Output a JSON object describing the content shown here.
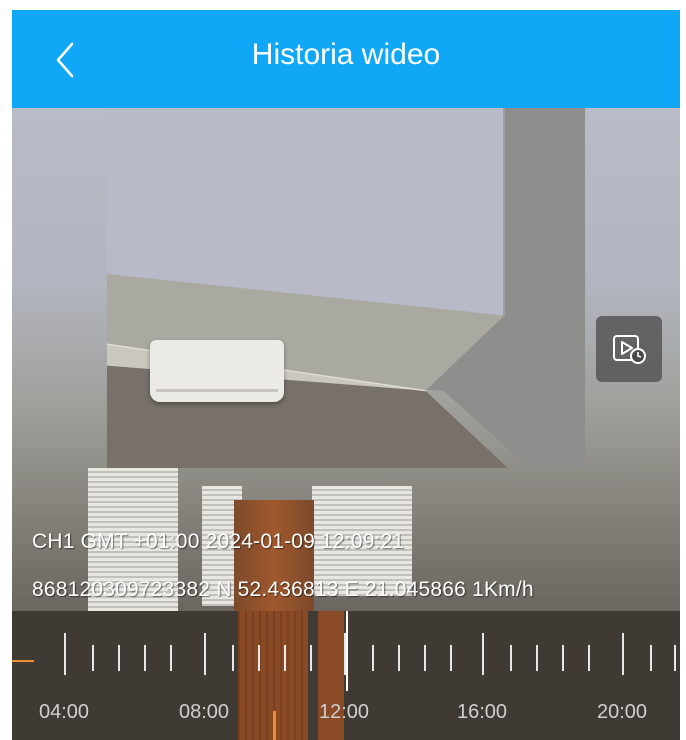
{
  "header": {
    "title": "Historia wideo",
    "background_color": "#10a8f6",
    "back_icon": "chevron-left-icon"
  },
  "video": {
    "osd_line1": "CH1  GMT +01:00 2024-01-09 12:09:21",
    "osd_line2": "868120309723382 N 52.436813 E 21.045866  1Km/h",
    "playback_icon": "playback-clock-icon"
  },
  "timeline": {
    "labels": [
      "04:00",
      "08:00",
      "12:00",
      "16:00",
      "20:00"
    ],
    "record_color": "#8a4a26",
    "marker_color": "#ee8f2c"
  }
}
